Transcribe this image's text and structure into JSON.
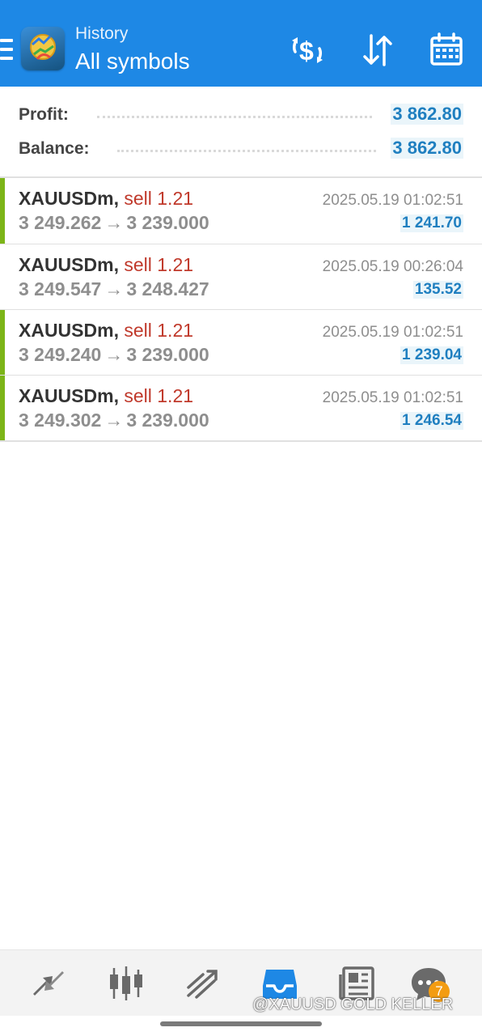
{
  "header": {
    "title_small": "History",
    "title_big": "All symbols",
    "background_color": "#1e88e5",
    "icons": [
      "menu-icon",
      "app-logo-icon",
      "deposit-withdraw-icon",
      "sort-icon",
      "calendar-icon"
    ]
  },
  "summary": {
    "profit_label": "Profit:",
    "profit_value": "3 862.80",
    "balance_label": "Balance:",
    "balance_value": "3 862.80"
  },
  "trades": [
    {
      "symbol": "XAUUSDm,",
      "side": "sell 1.21",
      "open_price": "3 249.262",
      "arrow": "→",
      "close_price": "3 239.000",
      "time": "2025.05.19 01:02:51",
      "profit": "1 241.70",
      "accent": true
    },
    {
      "symbol": "XAUUSDm,",
      "side": "sell 1.21",
      "open_price": "3 249.547",
      "arrow": "→",
      "close_price": "3 248.427",
      "time": "2025.05.19 00:26:04",
      "profit": "135.52",
      "accent": false
    },
    {
      "symbol": "XAUUSDm,",
      "side": "sell 1.21",
      "open_price": "3 249.240",
      "arrow": "→",
      "close_price": "3 239.000",
      "time": "2025.05.19 01:02:51",
      "profit": "1 239.04",
      "accent": true
    },
    {
      "symbol": "XAUUSDm,",
      "side": "sell 1.21",
      "open_price": "3 249.302",
      "arrow": "→",
      "close_price": "3 239.000",
      "time": "2025.05.19 01:02:51",
      "profit": "1 246.54",
      "accent": true
    }
  ],
  "colors": {
    "accent_green": "#7cb518",
    "sell_red": "#c0392b",
    "profit_blue": "#1f7fc0",
    "active_tab_blue": "#1e88e5",
    "badge_orange": "#f39c12"
  },
  "bottom_nav": {
    "items": [
      {
        "icon": "quotes-icon",
        "active": false
      },
      {
        "icon": "chart-icon",
        "active": false
      },
      {
        "icon": "trade-icon",
        "active": false
      },
      {
        "icon": "history-icon",
        "active": true
      },
      {
        "icon": "news-icon",
        "active": false
      },
      {
        "icon": "messages-icon",
        "active": false
      }
    ],
    "messages_badge": "7"
  },
  "watermark": "@XAUUSD GOLD KELLER"
}
